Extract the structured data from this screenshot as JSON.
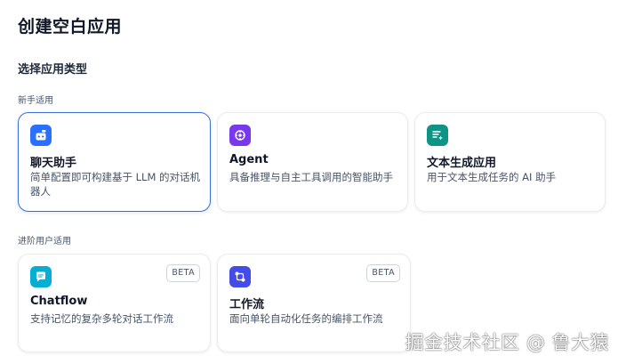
{
  "dialog": {
    "title": "创建空白应用",
    "section_title": "选择应用类型"
  },
  "groups": [
    {
      "label": "新手适用",
      "cards": [
        {
          "title": "聊天助手",
          "description": "简单配置即可构建基于 LLM 的对话机器人",
          "icon": "chat-robot-icon",
          "icon_color": "#2970ff",
          "selected": true
        },
        {
          "title": "Agent",
          "description": "具备推理与自主工具调用的智能助手",
          "icon": "agent-brain-icon",
          "icon_color": "#7839ee",
          "selected": false
        },
        {
          "title": "文本生成应用",
          "description": "用于文本生成任务的 AI 助手",
          "icon": "text-generator-icon",
          "icon_color": "#0e9384",
          "selected": false
        }
      ]
    },
    {
      "label": "进阶用户适用",
      "cards": [
        {
          "title": "Chatflow",
          "description": "支持记忆的复杂多轮对话工作流",
          "icon": "chatflow-icon",
          "icon_color": "#06aed4",
          "badge": "BETA",
          "selected": false
        },
        {
          "title": "工作流",
          "description": "面向单轮自动化任务的编排工作流",
          "icon": "workflow-icon",
          "icon_color": "#444ce7",
          "badge": "BETA",
          "selected": false
        }
      ]
    }
  ],
  "watermark": "掘金技术社区 @ 鲁大猿",
  "colors": {
    "selected_border": "#3b6fd8",
    "card_border": "#eaecf0"
  }
}
